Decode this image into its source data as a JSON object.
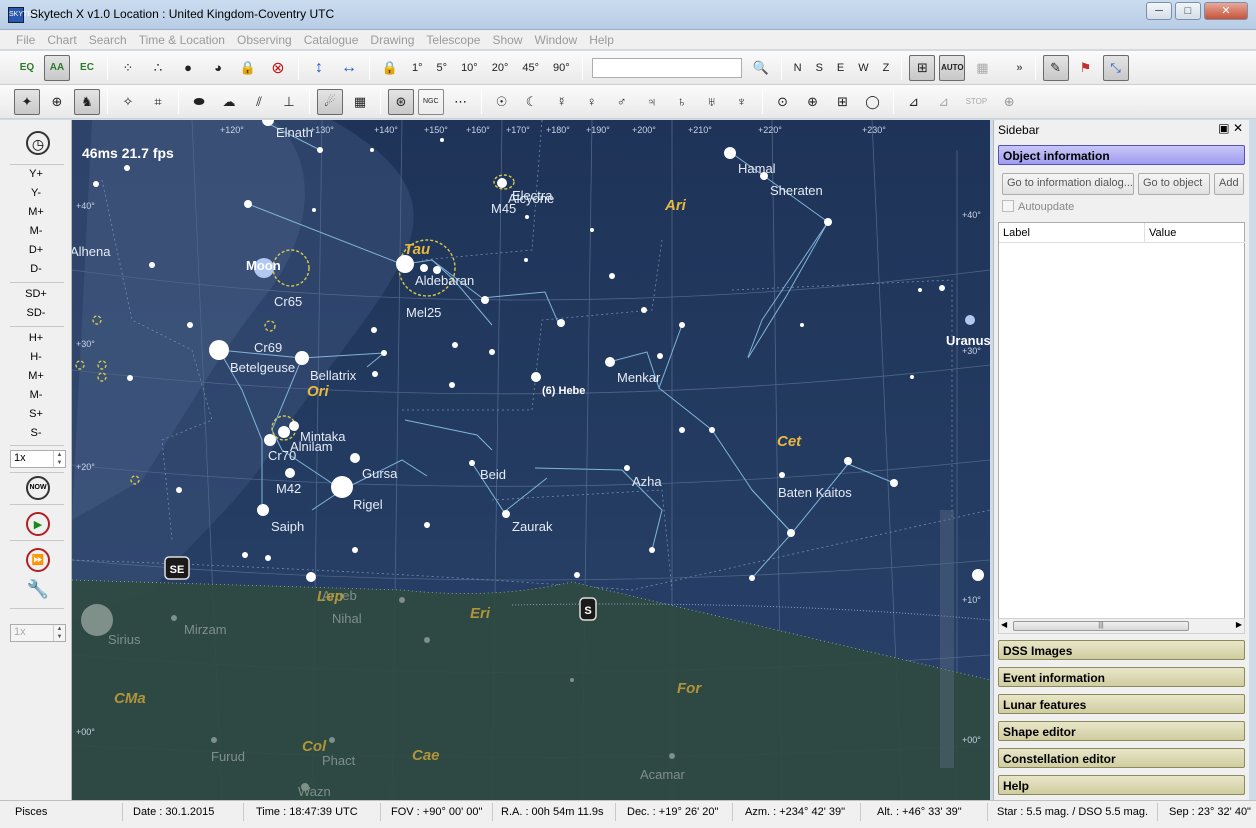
{
  "window": {
    "title": "Skytech X v1.0   Location : United Kingdom-Coventry  UTC",
    "icon_label": "SKYTECH",
    "controls": [
      "─",
      "□",
      "✕"
    ]
  },
  "menu": [
    "File",
    "Chart",
    "Search",
    "Time & Location",
    "Observing",
    "Catalogue",
    "Drawing",
    "Telescope",
    "Show",
    "Window",
    "Help"
  ],
  "toolbar1": {
    "coord_buttons": [
      "EQ",
      "AA",
      "EC"
    ],
    "fov_buttons": [
      "1°",
      "5°",
      "10°",
      "20°",
      "45°",
      "90°"
    ],
    "search_placeholder": "",
    "direction_buttons": [
      "N",
      "S",
      "E",
      "W",
      "Z"
    ],
    "auto_label": "AUTO",
    "overflow": "»"
  },
  "toolbar2": {
    "ngc_label": "NGC",
    "stop_label": "STOP"
  },
  "leftbar": {
    "buttons": [
      "Y+",
      "Y-",
      "M+",
      "M-",
      "D+",
      "D-",
      "SD+",
      "SD-",
      "H+",
      "H-",
      "M+",
      "M-",
      "S+",
      "S-"
    ],
    "step_value": "1x",
    "step_value2": "1x",
    "now_label": "NOW"
  },
  "sky": {
    "fps": "46ms 21.7 fps",
    "ra_labels": [
      "+120°",
      "+130°",
      "+140°",
      "+150°",
      "+160°",
      "+170°",
      "+180°",
      "+190°",
      "+200°",
      "+210°",
      "+220°",
      "+230°"
    ],
    "dec_labels_left": [
      "+40°",
      "+30°",
      "+20°",
      "+00°"
    ],
    "dec_labels_right": [
      "+40°",
      "+30°",
      "+10°",
      "+00°"
    ],
    "star_names": [
      "Elnath",
      "Alhena",
      "Moon",
      "Cr65",
      "Cr69",
      "Betelgeuse",
      "Bellatrix",
      "Mintaka",
      "Alnilam",
      "Cr70",
      "M42",
      "Gursa",
      "Rigel",
      "Saiph",
      "M45",
      "Electra",
      "Alcyone",
      "Aldebaran",
      "Mel25",
      "Hamal",
      "Sheraten",
      "Menkar",
      "Beid",
      "Zaurak",
      "Azha",
      "Baten Kaitos",
      "Uranus",
      "Sirius",
      "Mirzam",
      "Nihal",
      "Furud",
      "Phact",
      "Wazn",
      "Acamar",
      "Arneb"
    ],
    "minor_planet": "(6) Hebe",
    "constellations": [
      "Tau",
      "Ari",
      "Ori",
      "Cet",
      "Lep",
      "Eri",
      "CMa",
      "For",
      "Col",
      "Cae"
    ],
    "horizon_markers": [
      "SE",
      "S"
    ]
  },
  "sidebar": {
    "title": "Sidebar",
    "header_icons": "▣ ✕",
    "sections": [
      "Object information",
      "DSS Images",
      "Event information",
      "Lunar features",
      "Shape editor",
      "Constellation editor",
      "Help"
    ],
    "buttons": [
      "Go to information dialog...",
      "Go to object",
      "Add"
    ],
    "autoupdate": "Autoupdate",
    "table_headers": [
      "Label",
      "Value"
    ]
  },
  "status": {
    "constellation": "Pisces",
    "date": "Date : 30.1.2015",
    "time": "Time : 18:47:39 UTC",
    "fov": "FOV : +90° 00' 00\"",
    "ra": "R.A. : 00h 54m 11.9s",
    "dec": "Dec. : +19° 26' 20\"",
    "azm": "Azm. : +234° 42' 39\"",
    "alt": "Alt. : +46° 33' 39\"",
    "mag": "Star : 5.5 mag. / DSO 5.5 mag.",
    "sep": "Sep : 23° 32' 40\""
  }
}
